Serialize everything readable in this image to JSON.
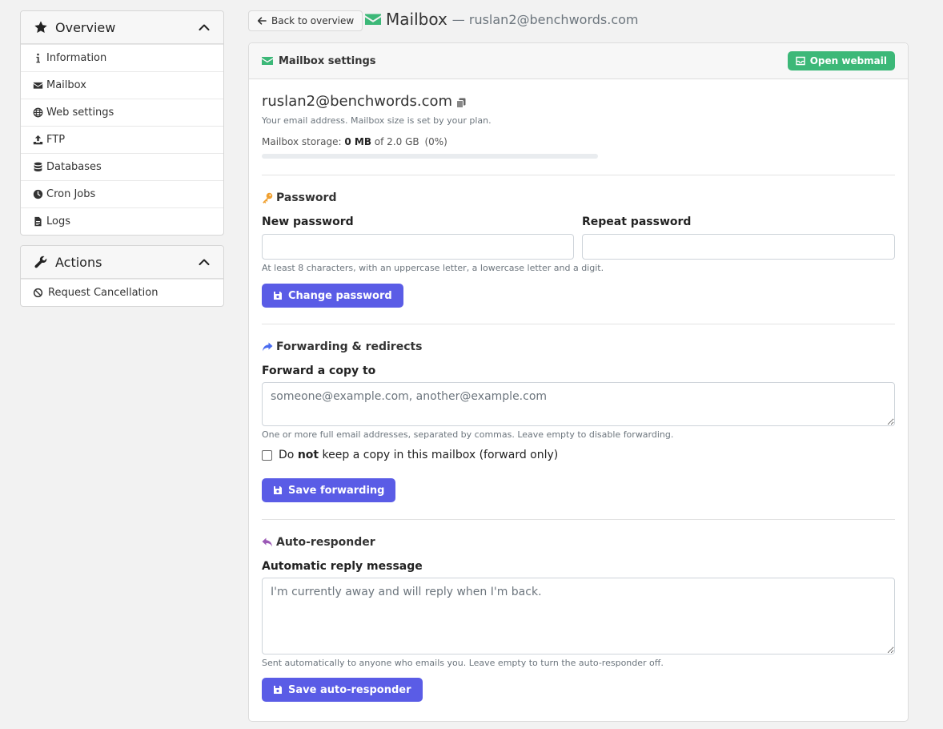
{
  "sidebar": {
    "overview": {
      "title": "Overview",
      "items": [
        {
          "label": "Information",
          "icon": "info-icon"
        },
        {
          "label": "Mailbox",
          "icon": "envelope-icon"
        },
        {
          "label": "Web settings",
          "icon": "globe-icon"
        },
        {
          "label": "FTP",
          "icon": "upload-icon"
        },
        {
          "label": "Databases",
          "icon": "database-icon"
        },
        {
          "label": "Cron Jobs",
          "icon": "clock-icon"
        },
        {
          "label": "Logs",
          "icon": "file-icon"
        }
      ]
    },
    "actions": {
      "title": "Actions",
      "items": [
        {
          "label": "Request Cancellation",
          "icon": "ban-icon"
        }
      ]
    }
  },
  "header": {
    "back_label": "Back to overview",
    "title": "Mailbox",
    "subtitle": "— ruslan2@benchwords.com"
  },
  "card": {
    "title": "Mailbox settings",
    "webmail_label": "Open webmail",
    "email": "ruslan2@benchwords.com",
    "email_hint": "Your email address. Mailbox size is set by your plan.",
    "storage": {
      "label": "Mailbox storage:",
      "used": "0 MB",
      "of_text": "of 2.0 GB",
      "percent_text": "(0%)",
      "fill_percent": 0
    }
  },
  "password": {
    "section_title": "Password",
    "new_label": "New password",
    "repeat_label": "Repeat password",
    "hint": "At least 8 characters, with an uppercase letter, a lowercase letter and a digit.",
    "button_label": "Change password"
  },
  "forwarding": {
    "section_title": "Forwarding & redirects",
    "label": "Forward a copy to",
    "placeholder": "someone@example.com, another@example.com",
    "hint": "One or more full email addresses, separated by commas. Leave empty to disable forwarding.",
    "checkbox_pre": "Do",
    "checkbox_bold": "not",
    "checkbox_post": "keep a copy in this mailbox (forward only)",
    "button_label": "Save forwarding"
  },
  "autoresponder": {
    "section_title": "Auto-responder",
    "label": "Automatic reply message",
    "placeholder": "I'm currently away and will reply when I'm back.",
    "hint": "Sent automatically to anyone who emails you. Leave empty to turn the auto-responder off.",
    "button_label": "Save auto-responder"
  },
  "colors": {
    "primary": "#5a5ce6",
    "success": "#3cb878",
    "key_icon": "#f0a030",
    "forward_icon": "#4a6cf0",
    "reply_icon": "#9b59b6"
  }
}
